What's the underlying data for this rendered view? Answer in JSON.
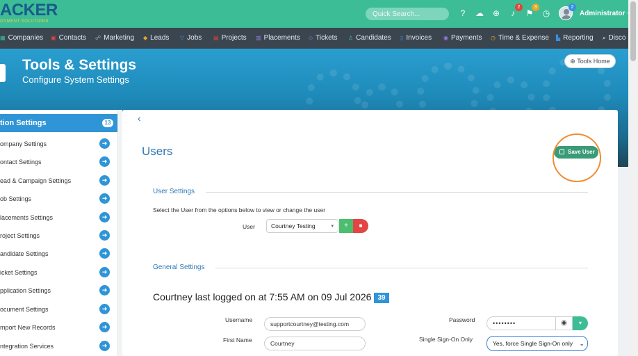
{
  "logo": {
    "main": "ACKER",
    "sub": "OYMENT SOLUTIONS"
  },
  "topbar": {
    "search_placeholder": "Quick Search...",
    "icons": [
      {
        "name": "help-icon",
        "glyph": "?",
        "badge": ""
      },
      {
        "name": "chat-icon",
        "glyph": "☁",
        "badge": ""
      },
      {
        "name": "add-icon",
        "glyph": "⊕",
        "badge": ""
      },
      {
        "name": "bell-icon",
        "glyph": "🔔",
        "badge": "2"
      },
      {
        "name": "flag-icon",
        "glyph": "⚑",
        "badge": "3"
      },
      {
        "name": "history-icon",
        "glyph": "◷",
        "badge": ""
      }
    ],
    "avatar_badge": "2",
    "user_label": "Administrator"
  },
  "nav": {
    "items": [
      {
        "label": "Companies"
      },
      {
        "label": "Contacts"
      },
      {
        "label": "Marketing"
      },
      {
        "label": "Leads"
      },
      {
        "label": "Jobs"
      },
      {
        "label": "Projects"
      },
      {
        "label": "Placements"
      },
      {
        "label": "Tickets"
      },
      {
        "label": "Candidates"
      },
      {
        "label": "Invoices"
      },
      {
        "label": "Payments"
      },
      {
        "label": "Time & Expense"
      },
      {
        "label": "Reporting"
      },
      {
        "label": "Disco"
      }
    ]
  },
  "hero": {
    "title": "Tools & Settings",
    "subtitle": "Configure System Settings",
    "tools_home": "Tools Home"
  },
  "sidebar": {
    "heading": "tion Settings",
    "count": "13",
    "items": [
      {
        "label": "ompany Settings"
      },
      {
        "label": "ontact Settings"
      },
      {
        "label": "ead & Campaign Settings"
      },
      {
        "label": "ob Settings"
      },
      {
        "label": "lacements Settings"
      },
      {
        "label": "roject Settings"
      },
      {
        "label": "andidate Settings"
      },
      {
        "label": "icket Settings"
      },
      {
        "label": "pplication Settings"
      },
      {
        "label": "ocument Settings"
      },
      {
        "label": "mport New Records"
      },
      {
        "label": "ntegration Services"
      }
    ]
  },
  "main": {
    "title": "Users",
    "save_label": "Save User",
    "user_settings_title": "User Settings",
    "description": "Select the User from the options below to view or change the user",
    "user_label": "User",
    "user_value": "Courtney Testing",
    "general_settings_title": "General Settings",
    "logged_text": "Courtney last logged on at 7:55 AM on 09 Jul 2026",
    "logged_badge": "39",
    "username_label": "Username",
    "username_value": "supportcourtney@testing.com",
    "first_name_label": "First Name",
    "first_name_value": "Courtney",
    "password_label": "Password",
    "password_value": "••••••••",
    "sso_label": "Single Sign-On Only",
    "sso_value": "Yes, force Single Sign-On only"
  }
}
